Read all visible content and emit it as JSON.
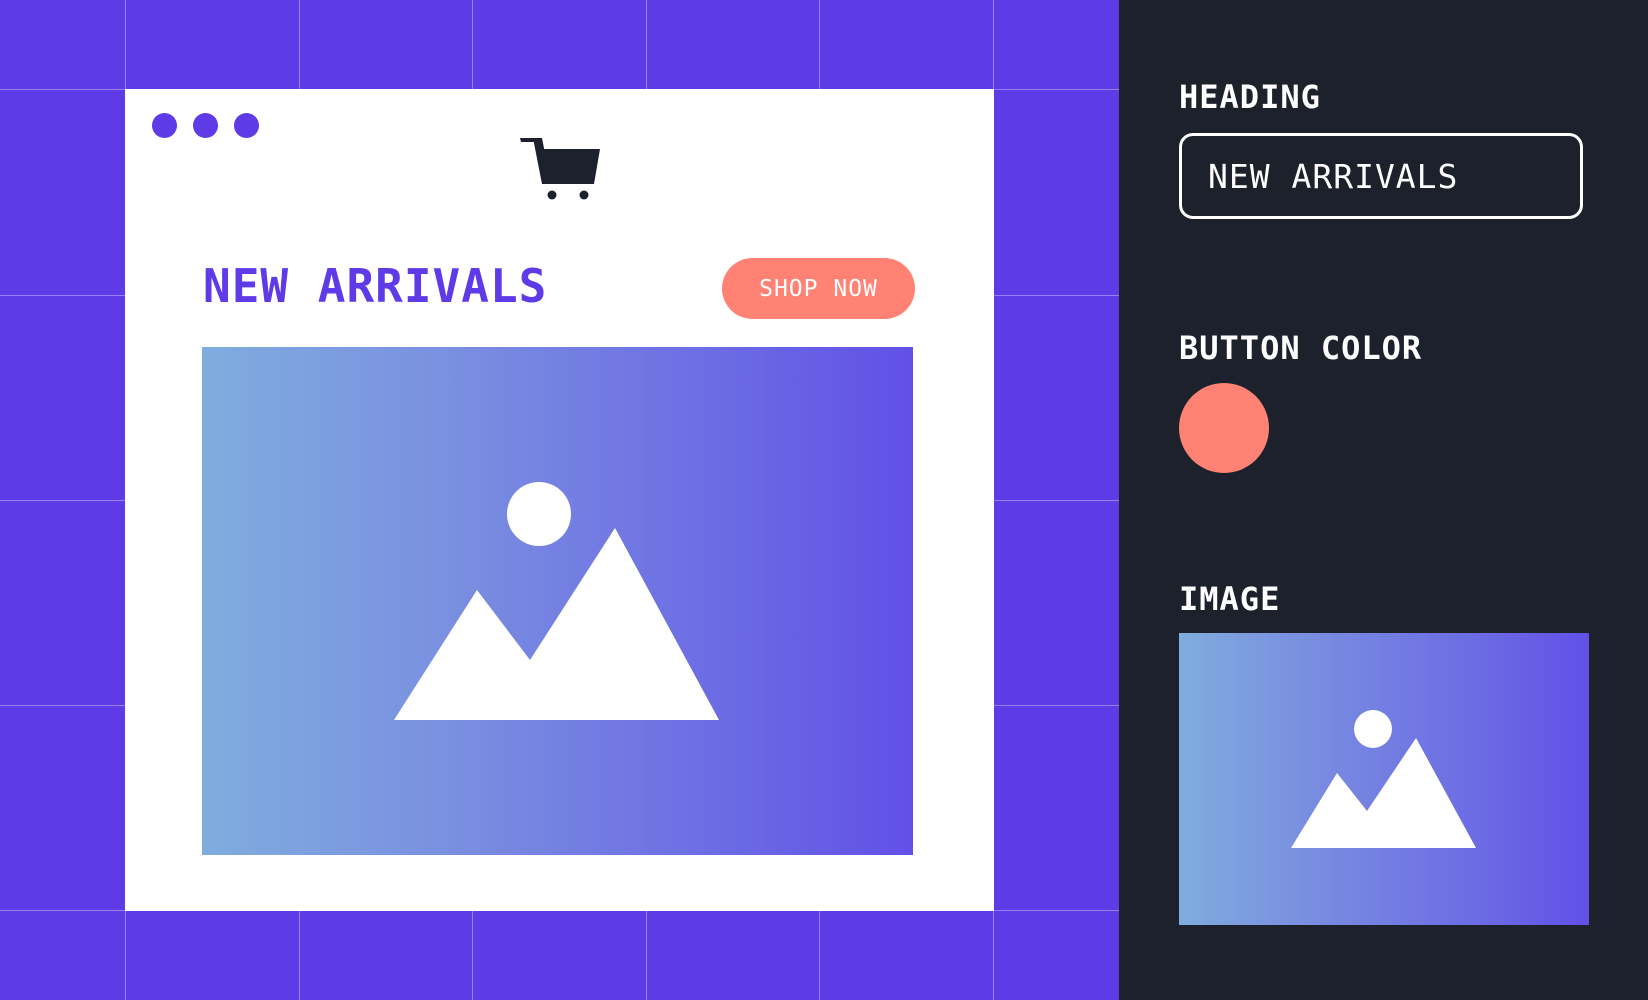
{
  "preview": {
    "heading": "NEW ARRIVALS",
    "button_label": "SHOP NOW",
    "window_dot_color": "#5e3be6",
    "canvas_color": "#5e3be6",
    "icons": {
      "cart": "shopping-cart-icon",
      "image_placeholder": "image-placeholder-icon"
    }
  },
  "panel": {
    "heading_label": "HEADING",
    "heading_value": "NEW ARRIVALS",
    "button_color_label": "BUTTON COLOR",
    "button_color": "#ff8274",
    "image_label": "IMAGE"
  }
}
